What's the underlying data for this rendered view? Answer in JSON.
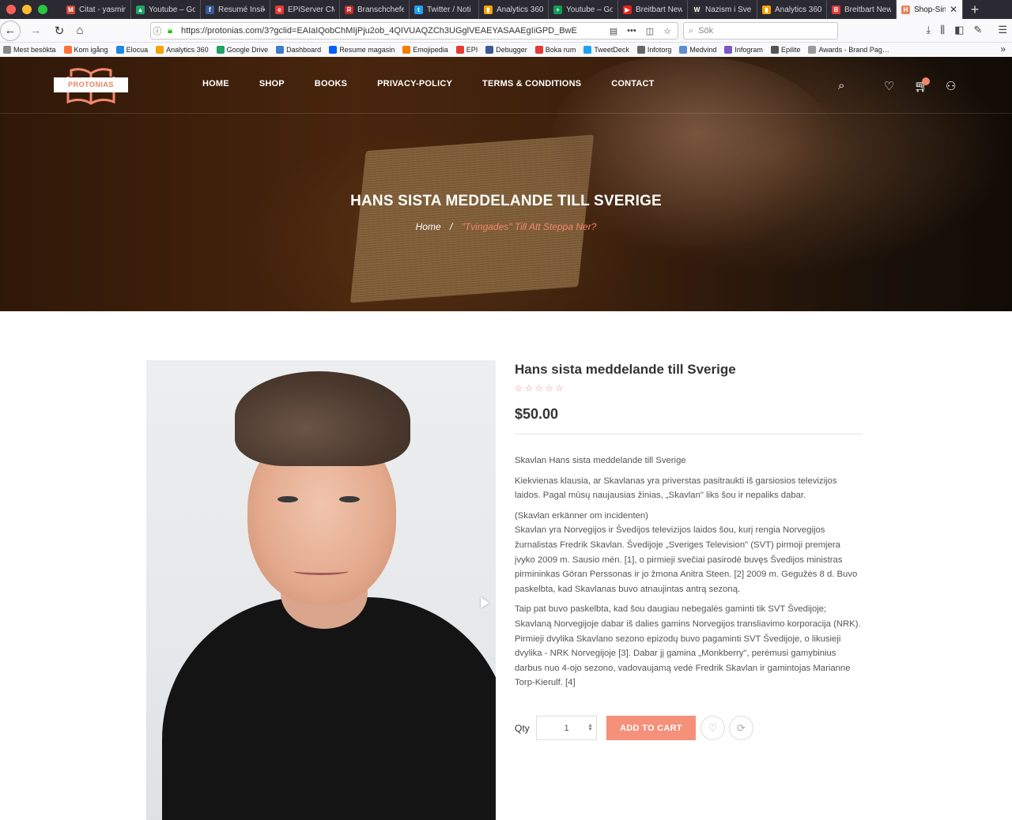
{
  "browser": {
    "tabs": [
      {
        "title": "Citat - yasmin",
        "color": "#d44638",
        "glyph": "M"
      },
      {
        "title": "Youtube – Go",
        "color": "#1fa463",
        "glyph": "▲"
      },
      {
        "title": "Resumé Insikt",
        "color": "#3b5998",
        "glyph": "f"
      },
      {
        "title": "EPiServer CM",
        "color": "#e53935",
        "glyph": "e"
      },
      {
        "title": "Branschchefe",
        "color": "#c62828",
        "glyph": "R"
      },
      {
        "title": "Twitter / Noti",
        "color": "#1da1f2",
        "glyph": "t"
      },
      {
        "title": "Analytics 360",
        "color": "#f4a300",
        "glyph": "▮"
      },
      {
        "title": "Youtube – Go",
        "color": "#0f9d58",
        "glyph": "+"
      },
      {
        "title": "Breitbart New",
        "color": "#e62117",
        "glyph": "▶"
      },
      {
        "title": "Nazism i Sver",
        "color": "#333333",
        "glyph": "W"
      },
      {
        "title": "Analytics 360",
        "color": "#f4a300",
        "glyph": "▮"
      },
      {
        "title": "Breitbart New",
        "color": "#e53935",
        "glyph": "B"
      },
      {
        "title": "Shop-Sing",
        "color": "#e8835c",
        "glyph": "H",
        "active": true
      }
    ],
    "url": "https://protonias.com/3?gclid=EAIaIQobChMIjPju2ob_4QIVUAQZCh3UGglVEAEYASAAEgIiGPD_BwE",
    "search_placeholder": "Sök",
    "bookmarks": [
      {
        "label": "Mest besökta",
        "color": "#888888"
      },
      {
        "label": "Kom igång",
        "color": "#ff7139"
      },
      {
        "label": "Elocua",
        "color": "#1e88e5"
      },
      {
        "label": "Analytics 360",
        "color": "#f4a300"
      },
      {
        "label": "Google Drive",
        "color": "#1fa463"
      },
      {
        "label": "Dashboard",
        "color": "#3d7ecb"
      },
      {
        "label": "Resume magasin",
        "color": "#0061ff"
      },
      {
        "label": "Emojipedia",
        "color": "#f57c00"
      },
      {
        "label": "EPI",
        "color": "#e53935"
      },
      {
        "label": "Debugger",
        "color": "#3b5998"
      },
      {
        "label": "Boka rum",
        "color": "#e53935"
      },
      {
        "label": "TweetDeck",
        "color": "#1da1f2"
      },
      {
        "label": "Infotorg",
        "color": "#666666"
      },
      {
        "label": "Medvind",
        "color": "#5c8fd6"
      },
      {
        "label": "Infogram",
        "color": "#7e57c2"
      },
      {
        "label": "Epilite",
        "color": "#555555"
      },
      {
        "label": "Awards - Brand Pag…",
        "color": "#999999"
      }
    ]
  },
  "site": {
    "logo_text": "PROTONIAS",
    "menu": [
      "HOME",
      "SHOP",
      "BOOKS",
      "PRIVACY-POLICY",
      "TERMS & CONDITIONS",
      "CONTACT"
    ],
    "hero_title": "HANS SISTA MEDDELANDE TILL SVERIGE",
    "breadcrumb": {
      "home": "Home",
      "separator": "/",
      "current": "\"Tvingades\" Till Att Steppa Ner?"
    },
    "accent": "#f3876b"
  },
  "product": {
    "title": "Hans sista meddelande till Sverige",
    "rating": "☆☆☆☆☆",
    "price": "$50.00",
    "description": [
      "Skavlan Hans sista meddelande till Sverige",
      "Kiekvienas klausia, ar Skavlanas yra priverstas pasitraukti iš garsiosios televizijos laidos. Pagal mūsų naujausias žinias, „Skavlan\" liks šou ir nepaliks dabar.",
      "(Skavlan erkänner om incidenten)",
      "Skavlan yra Norvegijos ir Švedijos televizijos laidos šou, kurį rengia Norvegijos žurnalistas Fredrik Skavlan. Švedijoje „Sveriges Television\" (SVT) pirmoji premjera įvyko 2009 m. Sausio mėn. [1], o pirmieji svečiai pasirodė buvęs Švedijos ministras pirmininkas Göran Perssonas ir jo žmona Anitra Steen. [2] 2009 m. Gegužės 8 d. Buvo paskelbta, kad Skavlanas buvo atnaujintas antrą sezoną.",
      "Taip pat buvo paskelbta, kad šou daugiau nebegalės gaminti tik SVT Švedijoje; Skavlaną Norvegijoje dabar iš dalies gamins Norvegijos transliavimo korporacija (NRK). Pirmieji dvylika Skavlano sezono epizodų buvo pagaminti SVT Švedijoje, o likusieji dvylika - NRK Norvegijoje [3]. Dabar jį gamina „Monkberry\", perėmusi gamybinius darbus nuo 4-ojo sezono, vadovaujamą vedė Fredrik Skavlan ir gamintojas Marianne Torp-Kierulf. [4]"
    ],
    "qty_label": "Qty",
    "qty_value": "1",
    "add_to_cart": "ADD TO CART"
  }
}
